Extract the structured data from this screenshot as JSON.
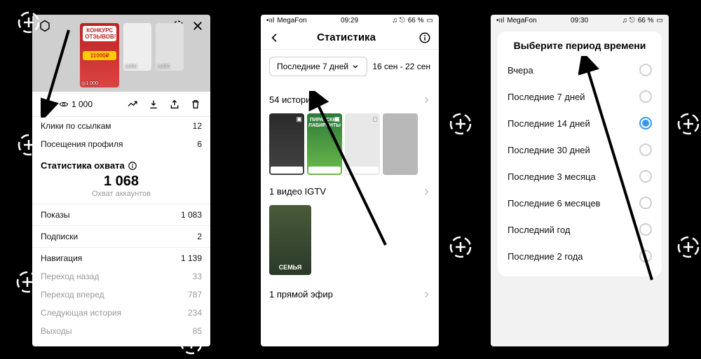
{
  "phone1": {
    "story_cards": [
      {
        "badge_top": "КОНКУРС ОТЗЫВОВ!",
        "price": "11000₽",
        "views_label": "◎1 000"
      },
      {
        "views_label": "◎901"
      },
      {
        "views_label": "◎680"
      }
    ],
    "tabs": {
      "views_label": "1 000"
    },
    "rows": {
      "link_clicks_label": "Клики по ссылкам",
      "link_clicks_value": "12",
      "profile_visits_label": "Посещения профиля",
      "profile_visits_value": "6"
    },
    "reach": {
      "title": "Статистика охвата",
      "big_num": "1 068",
      "big_sub": "Охват аккаунтов"
    },
    "metrics": {
      "impressions_label": "Показы",
      "impressions_value": "1 083",
      "follows_label": "Подписки",
      "follows_value": "2",
      "nav_label": "Навигация",
      "nav_value": "1 139",
      "back_label": "Переход назад",
      "back_value": "33",
      "fwd_label": "Переход вперед",
      "fwd_value": "787",
      "next_label": "Следующая история",
      "next_value": "234",
      "exits_label": "Выходы",
      "exits_value": "85"
    }
  },
  "phone2": {
    "status": {
      "carrier": "MegaFon",
      "time": "09:29",
      "battery": "66 %"
    },
    "header_title": "Статистика",
    "range_button": "Последние 7 дней",
    "range_text": "16 сен - 22 сен",
    "stories_row": "54 историй",
    "strip_card2_text": "ПИРАТСКИЕ ЛАБИРИНТЫ",
    "igtv_row": "1 видео IGTV",
    "igtv_card_label": "СЕМЬЯ",
    "live_row": "1 прямой эфир"
  },
  "phone3": {
    "status": {
      "carrier": "MegaFon",
      "time": "09:30",
      "battery": "66 %"
    },
    "sheet_title": "Выберите период времени",
    "items": [
      {
        "label": "Вчера",
        "selected": false
      },
      {
        "label": "Последние 7 дней",
        "selected": false
      },
      {
        "label": "Последние 14 дней",
        "selected": true
      },
      {
        "label": "Последние 30 дней",
        "selected": false
      },
      {
        "label": "Последние 3 месяца",
        "selected": false
      },
      {
        "label": "Последние 6 месяцев",
        "selected": false
      },
      {
        "label": "Последний год",
        "selected": false
      },
      {
        "label": "Последние 2 года",
        "selected": false
      }
    ]
  }
}
